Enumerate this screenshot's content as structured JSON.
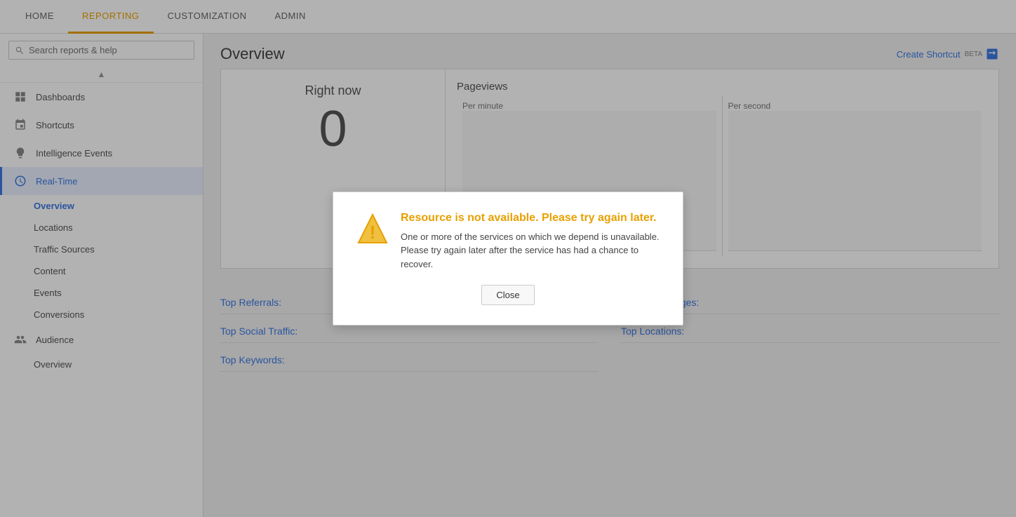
{
  "topNav": {
    "items": [
      {
        "id": "home",
        "label": "HOME",
        "active": false
      },
      {
        "id": "reporting",
        "label": "REPORTING",
        "active": true
      },
      {
        "id": "customization",
        "label": "CUSTOMIZATION",
        "active": false
      },
      {
        "id": "admin",
        "label": "ADMIN",
        "active": false
      }
    ]
  },
  "sidebar": {
    "searchPlaceholder": "Search reports & help",
    "navItems": [
      {
        "id": "dashboards",
        "label": "Dashboards",
        "icon": "grid"
      },
      {
        "id": "shortcuts",
        "label": "Shortcuts",
        "icon": "pin"
      },
      {
        "id": "intelligence-events",
        "label": "Intelligence Events",
        "icon": "bulb"
      },
      {
        "id": "real-time",
        "label": "Real-Time",
        "icon": "clock",
        "active": true
      }
    ],
    "subItems": [
      {
        "id": "overview",
        "label": "Overview",
        "active": true
      },
      {
        "id": "locations",
        "label": "Locations"
      },
      {
        "id": "traffic-sources",
        "label": "Traffic Sources"
      },
      {
        "id": "content",
        "label": "Content"
      },
      {
        "id": "events",
        "label": "Events"
      },
      {
        "id": "conversions",
        "label": "Conversions"
      }
    ],
    "audienceItem": {
      "id": "audience",
      "label": "Audience",
      "icon": "people"
    },
    "audienceSubItems": [
      {
        "id": "audience-overview",
        "label": "Overview"
      }
    ]
  },
  "header": {
    "pageTitle": "Overview",
    "createShortcut": "Create Shortcut",
    "betaLabel": "BETA"
  },
  "realtimeSection": {
    "rightNowLabel": "Right now",
    "rightNowNumber": "0",
    "pageviewsTitle": "Pageviews",
    "perMinuteLabel": "Per minute",
    "perSecondLabel": "Per second"
  },
  "bottomLinks": {
    "left": [
      {
        "id": "top-referrals",
        "label": "Top Referrals:"
      },
      {
        "id": "top-social",
        "label": "Top Social Traffic:"
      },
      {
        "id": "top-keywords",
        "label": "Top Keywords:"
      }
    ],
    "right": [
      {
        "id": "top-active-pages",
        "label": "Top Active Pages:"
      },
      {
        "id": "top-locations",
        "label": "Top Locations:"
      }
    ]
  },
  "modal": {
    "title": "Resource is not available. Please try again later.",
    "bodyText": "One or more of the services on which we depend is unavailable. Please try again later after the service has had a chance to recover.",
    "closeButtonLabel": "Close"
  }
}
